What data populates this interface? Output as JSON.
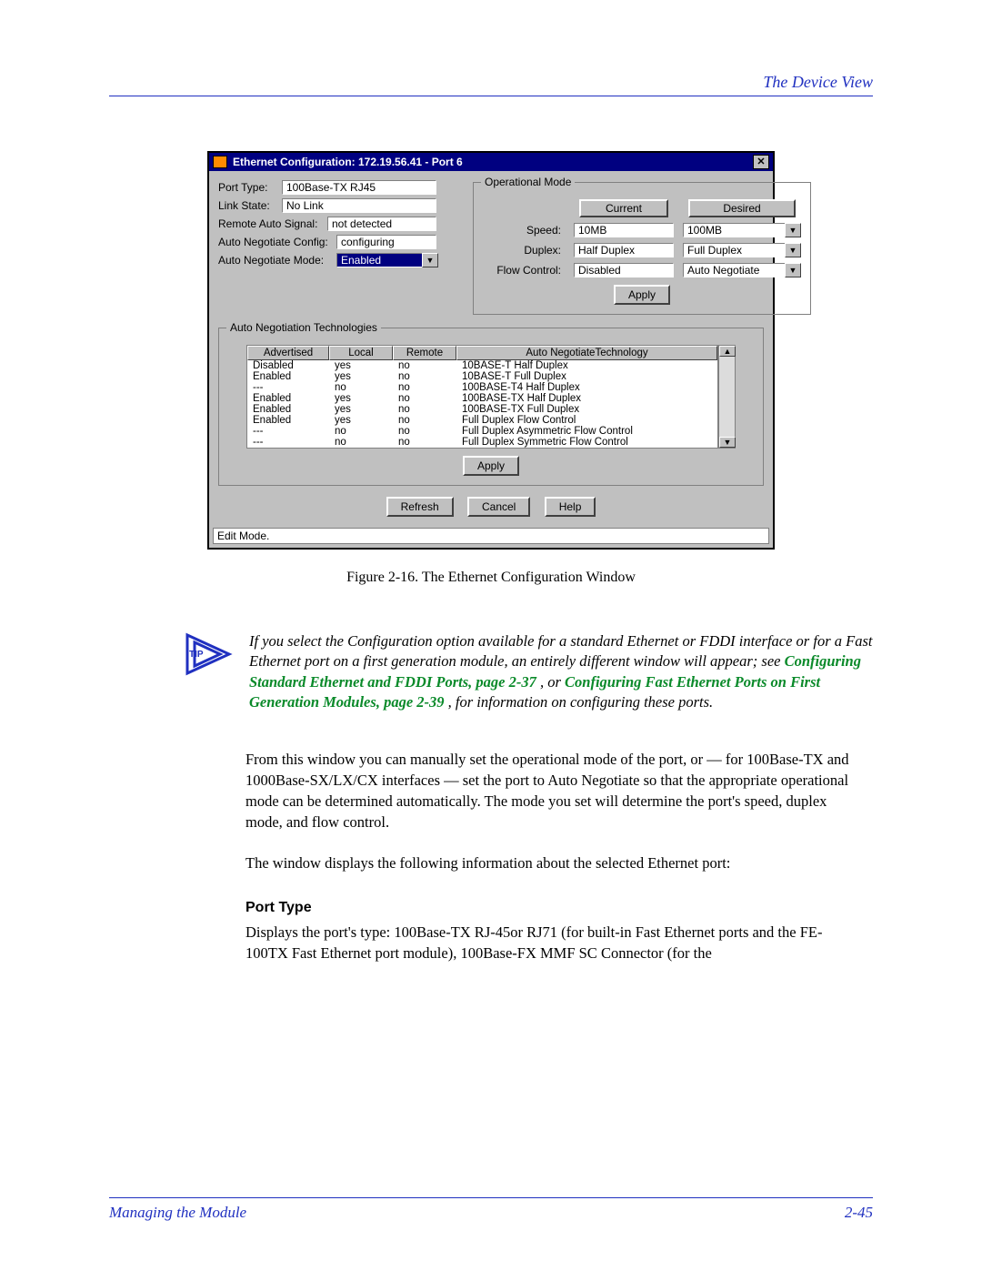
{
  "header": {
    "right": "The Device View"
  },
  "window": {
    "title": "Ethernet Configuration: 172.19.56.41 - Port 6",
    "close": "✕",
    "left": {
      "portTypeLabel": "Port Type:",
      "portTypeValue": "100Base-TX RJ45",
      "linkStateLabel": "Link State:",
      "linkStateValue": "No Link",
      "remoteAutoSignalLabel": "Remote Auto Signal:",
      "remoteAutoSignalValue": "not detected",
      "autoNegConfigLabel": "Auto Negotiate Config:",
      "autoNegConfigValue": "configuring",
      "autoNegModeLabel": "Auto Negotiate Mode:",
      "autoNegModeValue": "Enabled"
    },
    "opMode": {
      "groupTitle": "Operational Mode",
      "currentHdr": "Current",
      "desiredHdr": "Desired",
      "speedLabel": "Speed:",
      "speedCurrent": "10MB",
      "speedDesired": "100MB",
      "duplexLabel": "Duplex:",
      "duplexCurrent": "Half Duplex",
      "duplexDesired": "Full Duplex",
      "flowLabel": "Flow Control:",
      "flowCurrent": "Disabled",
      "flowDesired": "Auto Negotiate",
      "apply": "Apply"
    },
    "neg": {
      "groupTitle": "Auto Negotiation Technologies",
      "headers": {
        "advertised": "Advertised",
        "local": "Local",
        "remote": "Remote",
        "tech": "Auto NegotiateTechnology"
      },
      "rows": [
        {
          "adv": "Disabled",
          "local": "yes",
          "remote": "no",
          "tech": "10BASE-T Half Duplex"
        },
        {
          "adv": "Enabled",
          "local": "yes",
          "remote": "no",
          "tech": "10BASE-T Full Duplex"
        },
        {
          "adv": "---",
          "local": "no",
          "remote": "no",
          "tech": "100BASE-T4 Half Duplex"
        },
        {
          "adv": "Enabled",
          "local": "yes",
          "remote": "no",
          "tech": "100BASE-TX Half Duplex"
        },
        {
          "adv": "Enabled",
          "local": "yes",
          "remote": "no",
          "tech": "100BASE-TX Full Duplex"
        },
        {
          "adv": "Enabled",
          "local": "yes",
          "remote": "no",
          "tech": "Full Duplex Flow Control"
        },
        {
          "adv": "---",
          "local": "no",
          "remote": "no",
          "tech": "Full Duplex Asymmetric Flow Control"
        },
        {
          "adv": "---",
          "local": "no",
          "remote": "no",
          "tech": "Full Duplex Symmetric Flow Control"
        }
      ],
      "apply": "Apply"
    },
    "buttons": {
      "refresh": "Refresh",
      "cancel": "Cancel",
      "help": "Help"
    },
    "status": "Edit Mode."
  },
  "caption": "Figure 2-16. The Ethernet Configuration Window",
  "tip": {
    "badge": "TIP",
    "t1": "If you select the Configuration option available for a standard Ethernet or FDDI interface or for a Fast Ethernet port on a first generation module, an entirely different window will appear; see ",
    "link1a": "Configuring Standard Ethernet and FDDI Ports",
    "link1b": ", page 2-37",
    "t2": ", or ",
    "link2a": "Configuring Fast Ethernet Ports on First Generation Modules",
    "link2b": ", page 2-39",
    "t3": ", for information on configuring these ports."
  },
  "para1": "From this window you can manually set the operational mode of the port, or — for 100Base-TX and 1000Base-SX/LX/CX interfaces — set the port to Auto Negotiate so that the appropriate operational mode can be determined automatically. The mode you set will determine the port's speed, duplex mode, and flow control.",
  "para2": "The window displays the following information about the selected Ethernet port:",
  "sectionHeading": "Port Type",
  "para3": "Displays the port's type: 100Base-TX RJ-45or RJ71 (for built-in Fast Ethernet ports and the FE-100TX Fast Ethernet port module), 100Base-FX MMF SC Connector (for the",
  "footer": {
    "left": "Managing the Module",
    "right": "2-45"
  }
}
